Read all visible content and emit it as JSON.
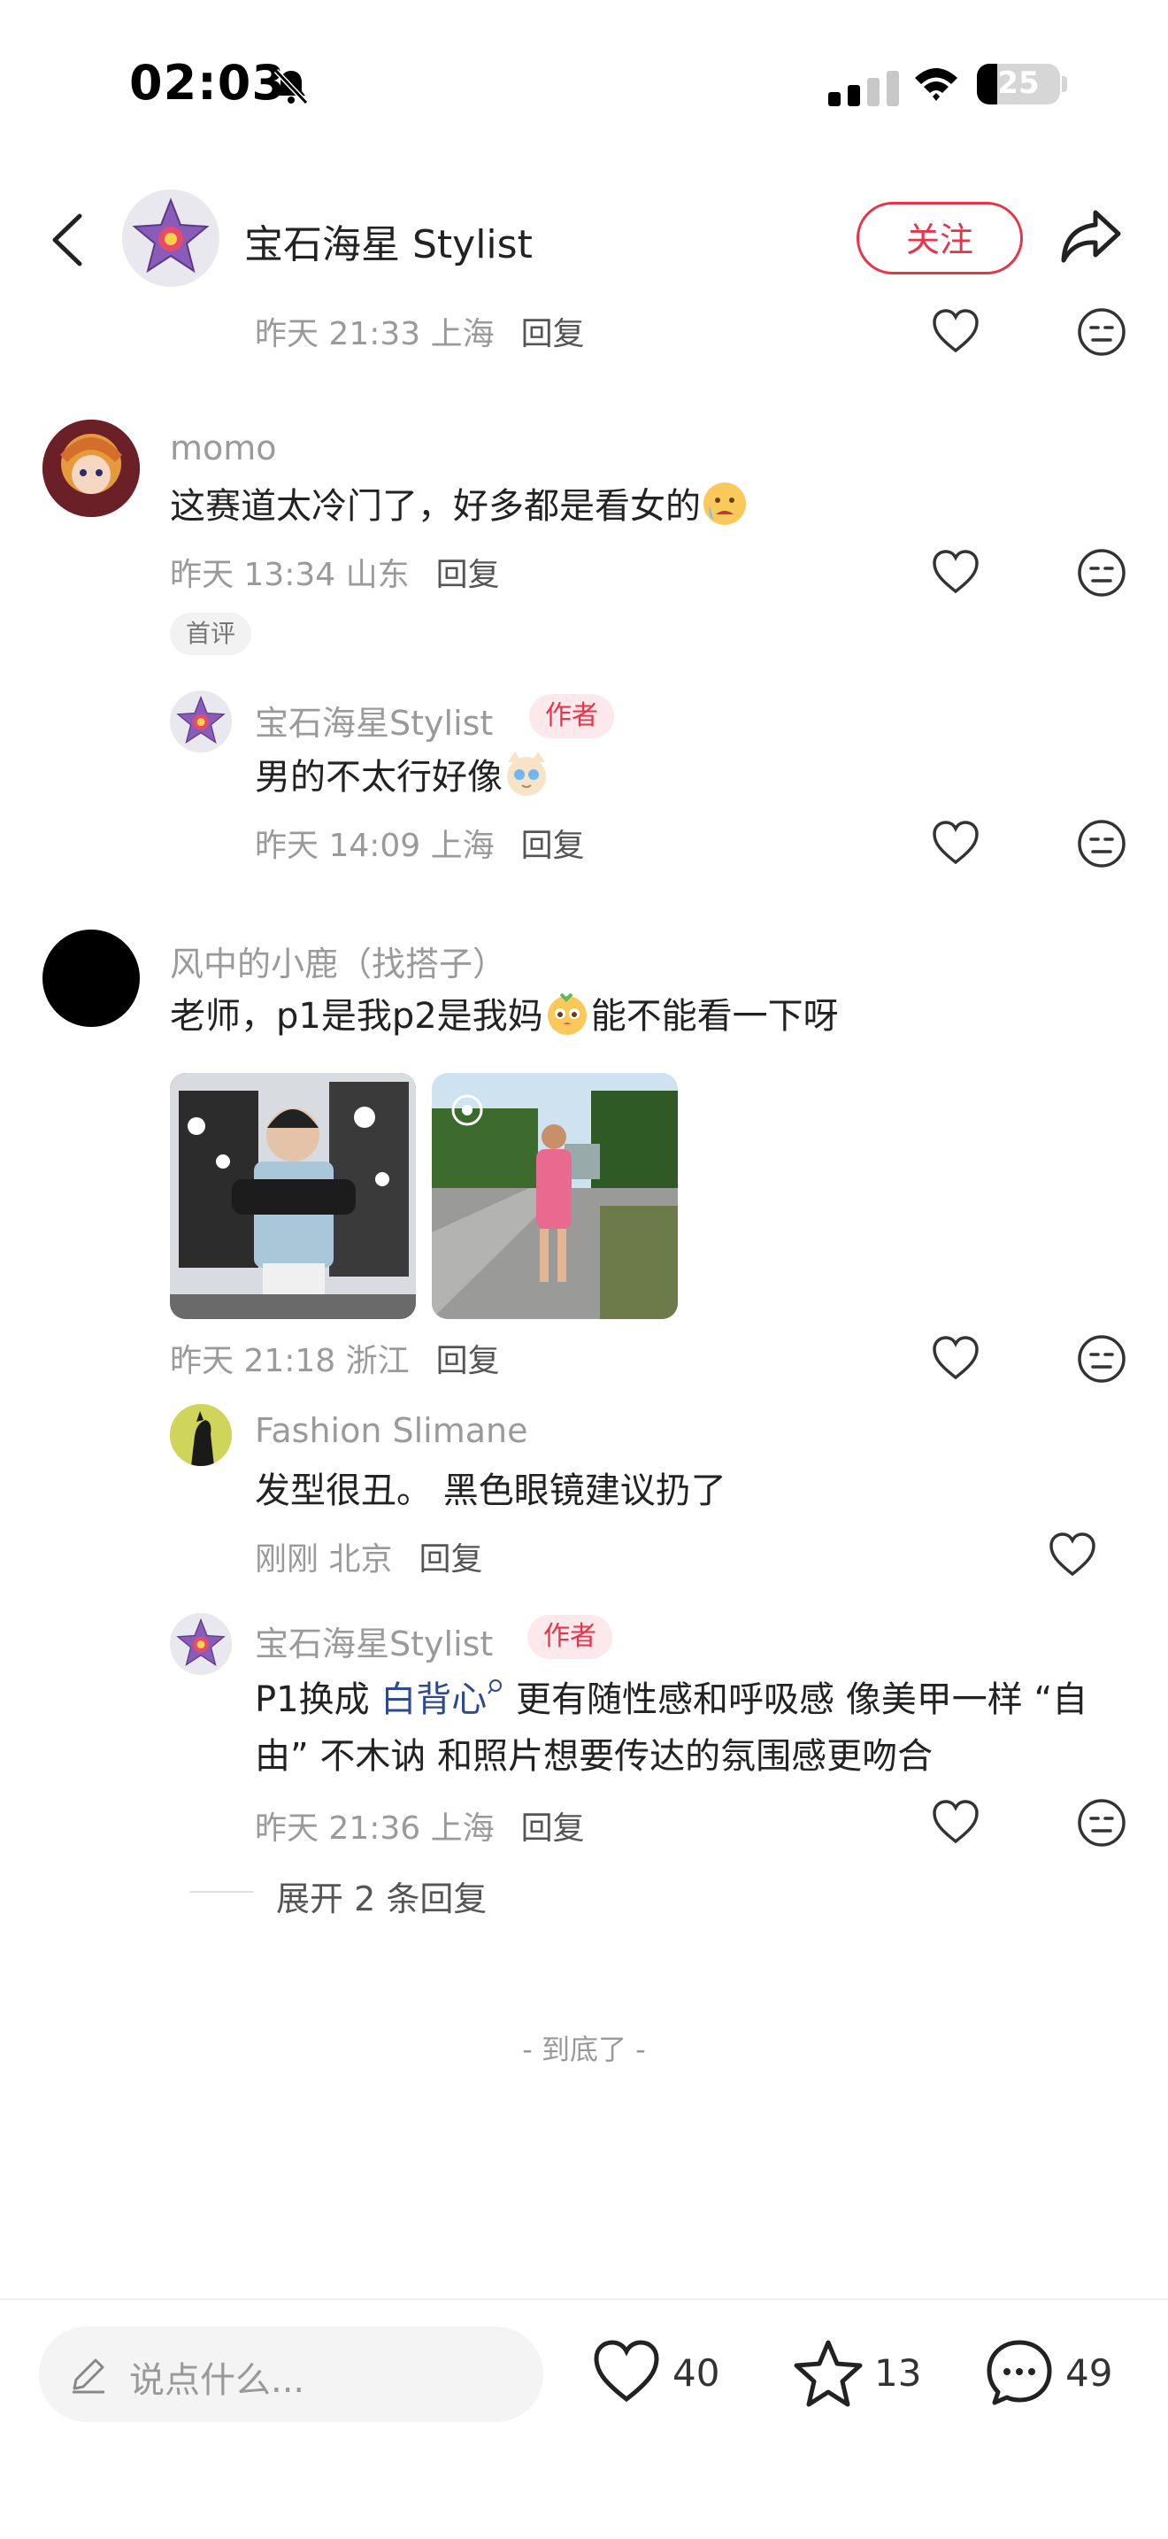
{
  "status_bar": {
    "time": "02:03",
    "battery": "25"
  },
  "header": {
    "title": "宝石海星 Stylist",
    "follow_label": "关注"
  },
  "top_partial": {
    "time": "昨天 21:33",
    "location": "上海",
    "reply": "回复"
  },
  "comments": [
    {
      "username": "momo",
      "text": "这赛道太冷门了，好多都是看女的",
      "time": "昨天 13:34",
      "location": "山东",
      "reply": "回复",
      "badge": "首评",
      "sub": {
        "username": "宝石海星Stylist",
        "author_badge": "作者",
        "text": "男的不太行好像",
        "time": "昨天 14:09",
        "location": "上海",
        "reply": "回复"
      }
    },
    {
      "username": "风中的小鹿（找搭子）",
      "text_a": "老师，p1是我p2是我妈",
      "text_b": "能不能看一下呀",
      "time": "昨天 21:18",
      "location": "浙江",
      "reply": "回复",
      "sub1": {
        "username": "Fashion Slimane",
        "text": "发型很丑。 黑色眼镜建议扔了",
        "time": "刚刚",
        "location": "北京",
        "reply": "回复"
      },
      "sub2": {
        "username": "宝石海星Stylist",
        "author_badge": "作者",
        "text_a": "P1换成 ",
        "link": "白背心",
        "text_b": " 更有随性感和呼吸感 像美甲一样 “自",
        "text_c": "由” 不木讷 和照片想要传达的氛围感更吻合",
        "time": "昨天 21:36",
        "location": "上海",
        "reply": "回复"
      },
      "expand": "展开 2 条回复"
    }
  ],
  "end_text": "- 到底了 -",
  "bottom_bar": {
    "placeholder": "说点什么...",
    "likes": "40",
    "stars": "13",
    "comments": "49"
  },
  "colors": {
    "accent": "#e8334a",
    "link": "#2e4a8f"
  }
}
